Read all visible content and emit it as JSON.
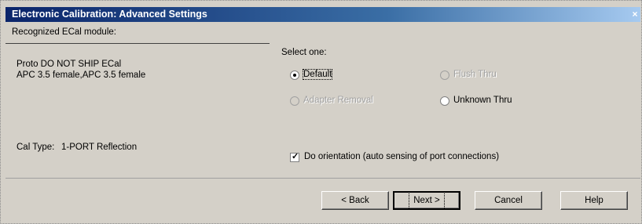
{
  "window": {
    "title": "Electronic Calibration: Advanced Settings",
    "close_glyph": "×"
  },
  "module": {
    "header": "Recognized ECal module:",
    "name": "Proto DO NOT SHIP ECal",
    "connectors": "APC 3.5 female,APC 3.5 female",
    "cal_type_label": "Cal Type:",
    "cal_type_value": "1-PORT Reflection"
  },
  "select": {
    "prompt": "Select one:",
    "options": [
      {
        "label": "Default",
        "checked": true,
        "enabled": true
      },
      {
        "label": "Flush Thru",
        "checked": false,
        "enabled": false
      },
      {
        "label": "Adapter Removal",
        "checked": false,
        "enabled": false
      },
      {
        "label": "Unknown Thru",
        "checked": false,
        "enabled": true
      }
    ]
  },
  "orientation": {
    "label": "Do orientation (auto sensing of port connections)",
    "checked": true
  },
  "buttons": {
    "back": "< Back",
    "next": "Next >",
    "cancel": "Cancel",
    "help": "Help"
  }
}
